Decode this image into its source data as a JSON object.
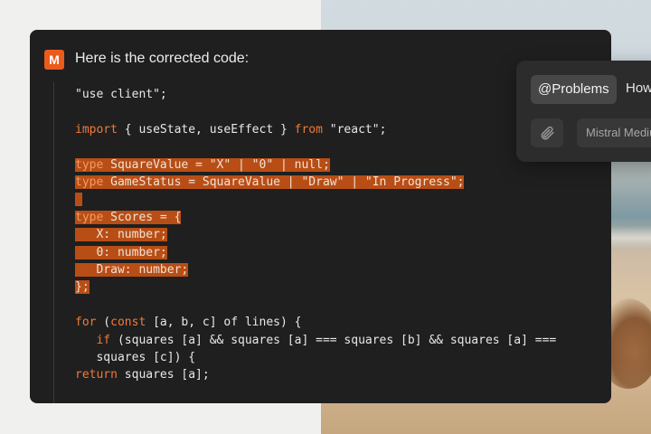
{
  "assistant": {
    "logo_letter": "M",
    "message": "Here is the corrected code:"
  },
  "code": {
    "lines": [
      {
        "parts": [
          {
            "t": "\"use client\";"
          }
        ]
      },
      {
        "parts": []
      },
      {
        "parts": [
          {
            "t": "import",
            "k": true
          },
          {
            "t": " { useState, useEffect } "
          },
          {
            "t": "from",
            "k": true
          },
          {
            "t": " \"react\";"
          }
        ]
      },
      {
        "parts": []
      },
      {
        "hl": true,
        "parts": [
          {
            "t": "type",
            "k": true
          },
          {
            "t": " SquareValue = \"X\" | \"0\" | null;"
          }
        ]
      },
      {
        "hl": true,
        "parts": [
          {
            "t": "type",
            "k": true
          },
          {
            "t": " GameStatus = SquareValue | \"Draw\" | \"In Progress\";"
          }
        ]
      },
      {
        "hl": true,
        "parts": [
          {
            "t": ""
          }
        ]
      },
      {
        "hl": true,
        "parts": [
          {
            "t": "type",
            "k": true
          },
          {
            "t": " Scores = {"
          }
        ]
      },
      {
        "hl": true,
        "parts": [
          {
            "t": "   X: number;"
          }
        ]
      },
      {
        "hl": true,
        "parts": [
          {
            "t": "   0: number;"
          }
        ]
      },
      {
        "hl": true,
        "parts": [
          {
            "t": "   Draw: number;"
          }
        ]
      },
      {
        "hl": true,
        "parts": [
          {
            "t": "};"
          }
        ]
      },
      {
        "parts": []
      },
      {
        "parts": [
          {
            "t": "for",
            "k": true
          },
          {
            "t": " ("
          },
          {
            "t": "const",
            "k": true
          },
          {
            "t": " [a, b, c] of lines) {"
          }
        ]
      },
      {
        "parts": [
          {
            "t": "   "
          },
          {
            "t": "if",
            "k": true
          },
          {
            "t": " (squares [a] && squares [a] === squares [b] && squares [a] ==="
          }
        ]
      },
      {
        "parts": [
          {
            "t": "   squares [c]) {"
          }
        ]
      },
      {
        "parts": [
          {
            "t": "return",
            "k": true
          },
          {
            "t": " squares [a];"
          }
        ]
      }
    ]
  },
  "prompt_card": {
    "tag": "@Problems",
    "text": "How",
    "model": "Mistral Medium"
  },
  "colors": {
    "accent": "#ea5b1c",
    "highlight": "#b84e16",
    "panel": "#1f1f1f"
  }
}
